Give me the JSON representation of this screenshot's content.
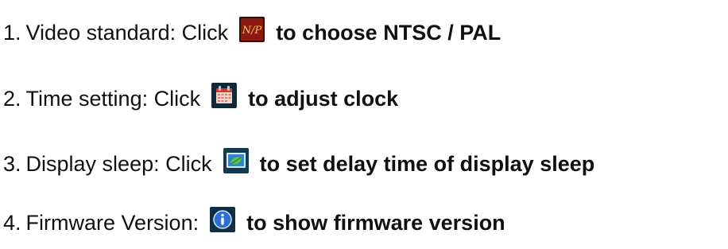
{
  "items": [
    {
      "number": "1.",
      "lead": "Video standard: Click",
      "icon": "ntsc-pal-icon",
      "icon_text": "N/P",
      "action": "to choose NTSC / PAL"
    },
    {
      "number": "2.",
      "lead": "Time setting: Click",
      "icon": "calendar-icon",
      "action": "to adjust clock"
    },
    {
      "number": "3.",
      "lead": "Display sleep: Click",
      "icon": "display-picture-icon",
      "action": "to set delay time of display sleep"
    },
    {
      "number": "4.",
      "lead": "Firmware Version:",
      "icon": "info-icon",
      "action": "to show firmware version"
    }
  ],
  "colors": {
    "text": "#111111",
    "ntsc_icon_bg": "#8b1a12",
    "ntsc_icon_text": "#f2c94c",
    "calendar_frame": "#0e2a3a",
    "calendar_page": "#f4d6c8",
    "display_frame": "#123a52",
    "display_screen": "#2f86c9",
    "info_frame": "#0f2f44",
    "info_circle": "#2a6fd1"
  }
}
